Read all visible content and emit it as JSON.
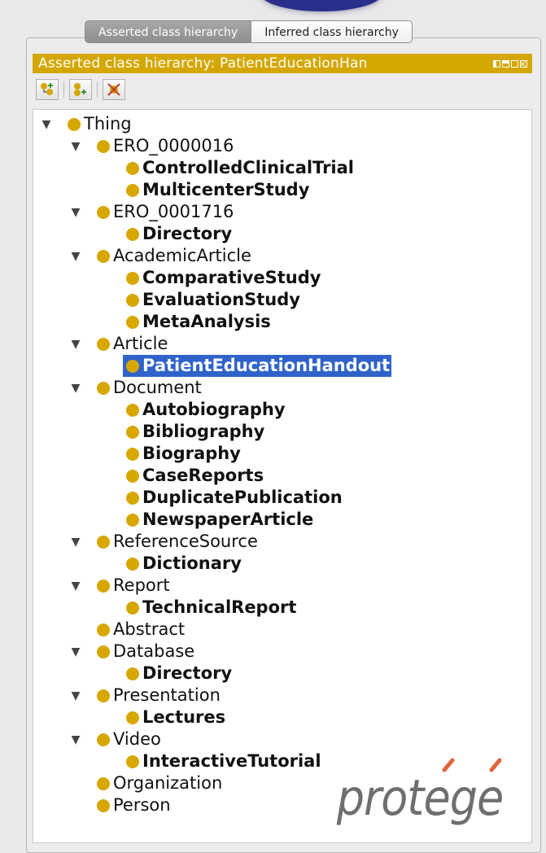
{
  "tabs": [
    {
      "label": "Asserted class hierarchy",
      "selected": true
    },
    {
      "label": "Inferred class hierarchy",
      "selected": false
    }
  ],
  "view": {
    "title": "Asserted class hierarchy: PatientEducationHan",
    "header_color": "#d4a700"
  },
  "toolbar": {
    "buttons": [
      "add-subclass-icon",
      "add-sibling-class-icon",
      "delete-class-icon"
    ]
  },
  "colors": {
    "class_dot": "#d7a700",
    "selection": "#2f63c9"
  },
  "tree": [
    {
      "label": "Thing",
      "bold": false,
      "expanded": true
    },
    {
      "label": "ERO_0000016",
      "bold": false,
      "expanded": true
    },
    {
      "label": "ControlledClinicalTrial",
      "bold": true
    },
    {
      "label": "MulticenterStudy",
      "bold": true
    },
    {
      "label": "ERO_0001716",
      "bold": false,
      "expanded": true
    },
    {
      "label": "Directory",
      "bold": true
    },
    {
      "label": "AcademicArticle",
      "bold": false,
      "expanded": true
    },
    {
      "label": "ComparativeStudy",
      "bold": true
    },
    {
      "label": "EvaluationStudy",
      "bold": true
    },
    {
      "label": "MetaAnalysis",
      "bold": true
    },
    {
      "label": "Article",
      "bold": false,
      "expanded": true
    },
    {
      "label": "PatientEducationHandout",
      "bold": true,
      "selected": true
    },
    {
      "label": "Document",
      "bold": false,
      "expanded": true
    },
    {
      "label": "Autobiography",
      "bold": true
    },
    {
      "label": "Bibliography",
      "bold": true
    },
    {
      "label": "Biography",
      "bold": true
    },
    {
      "label": "CaseReports",
      "bold": true
    },
    {
      "label": "DuplicatePublication",
      "bold": true
    },
    {
      "label": "NewspaperArticle",
      "bold": true
    },
    {
      "label": "ReferenceSource",
      "bold": false,
      "expanded": true
    },
    {
      "label": "Dictionary",
      "bold": true
    },
    {
      "label": "Report",
      "bold": false,
      "expanded": true
    },
    {
      "label": "TechnicalReport",
      "bold": true
    },
    {
      "label": "Abstract",
      "bold": false
    },
    {
      "label": "Database",
      "bold": false,
      "expanded": true
    },
    {
      "label": "Directory",
      "bold": true
    },
    {
      "label": "Presentation",
      "bold": false,
      "expanded": true
    },
    {
      "label": "Lectures",
      "bold": true
    },
    {
      "label": "Video",
      "bold": false,
      "expanded": true
    },
    {
      "label": "InteractiveTutorial",
      "bold": true
    },
    {
      "label": "Organization",
      "bold": false
    },
    {
      "label": "Person",
      "bold": false
    }
  ],
  "logo": {
    "text": "protege"
  }
}
